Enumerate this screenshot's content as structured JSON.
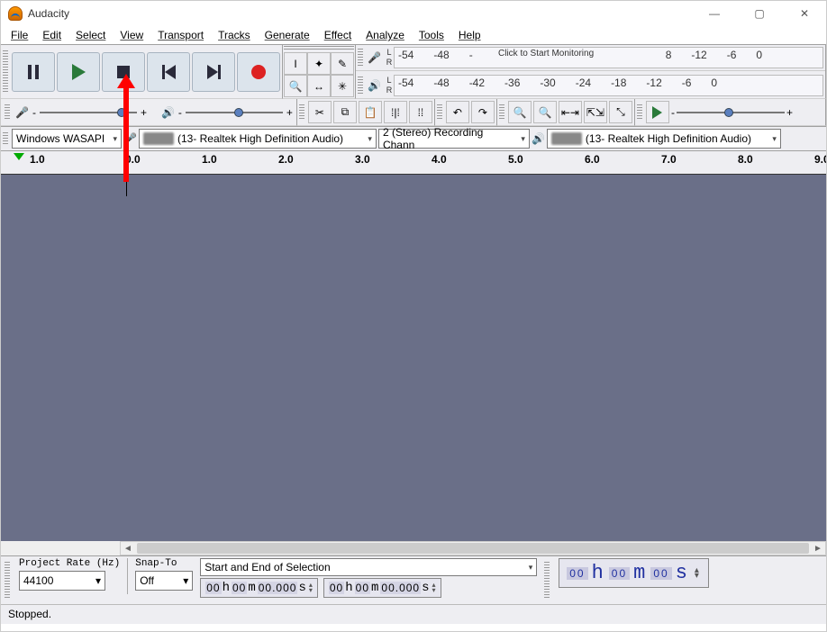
{
  "title": "Audacity",
  "menu": [
    "File",
    "Edit",
    "Select",
    "View",
    "Transport",
    "Tracks",
    "Generate",
    "Effect",
    "Analyze",
    "Tools",
    "Help"
  ],
  "meters": {
    "rec_ticks": [
      "-54",
      "-48",
      "-",
      "",
      "",
      "8",
      "-12",
      "-6",
      "0"
    ],
    "rec_prompt": "Click to Start Monitoring",
    "play_ticks": [
      "-54",
      "-48",
      "-42",
      "-36",
      "-30",
      "-24",
      "-18",
      "-12",
      "-6",
      "0"
    ]
  },
  "slider": {
    "minus": "-",
    "plus": "+"
  },
  "device": {
    "host": "Windows WASAPI",
    "rec_device": "(13- Realtek High Definition Audio)",
    "channels": "2 (Stereo) Recording Chann",
    "play_device": "(13- Realtek High Definition Audio)"
  },
  "ruler": [
    "1.0",
    "0.0",
    "1.0",
    "2.0",
    "3.0",
    "4.0",
    "5.0",
    "6.0",
    "7.0",
    "8.0",
    "9.0"
  ],
  "selection": {
    "project_rate_label": "Project Rate (Hz)",
    "project_rate": "44100",
    "snap_label": "Snap-To",
    "snap": "Off",
    "mode": "Start and End of Selection",
    "start": {
      "h": "00",
      "m": "00",
      "s": "00.000"
    },
    "end": {
      "h": "00",
      "m": "00",
      "s": "00.000"
    },
    "big": {
      "h": "00",
      "m": "00",
      "s": "00"
    }
  },
  "status": "Stopped."
}
